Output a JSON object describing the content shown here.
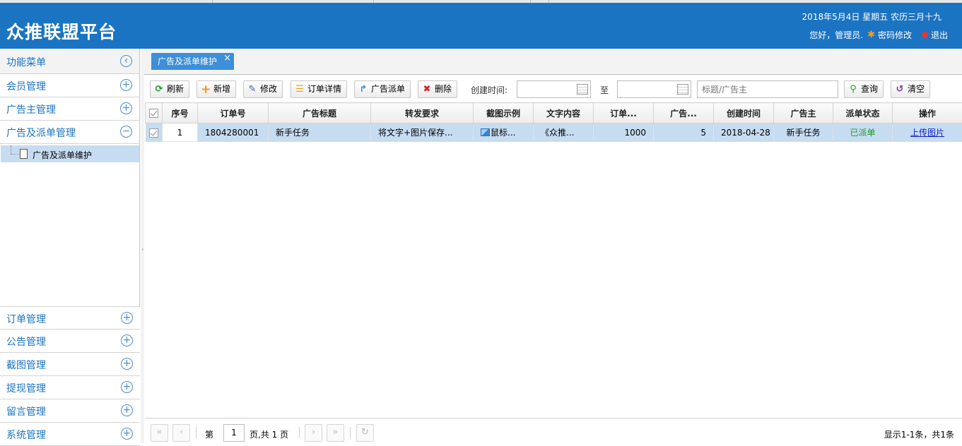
{
  "header": {
    "title": "众推联盟平台",
    "date": "2018年5月4日 星期五 农历三月十九",
    "greeting": "您好，管理员.",
    "change_password": "密码修改",
    "logout": "退出"
  },
  "sidebar": {
    "heading": "功能菜单",
    "items_top": [
      {
        "label": "会员管理",
        "toggle": "+"
      },
      {
        "label": "广告主管理",
        "toggle": "+"
      },
      {
        "label": "广告及派单管理",
        "toggle": "−"
      }
    ],
    "sub_item": "广告及派单维护",
    "items_bottom": [
      {
        "label": "订单管理",
        "toggle": "+"
      },
      {
        "label": "公告管理",
        "toggle": "+"
      },
      {
        "label": "截图管理",
        "toggle": "+"
      },
      {
        "label": "提现管理",
        "toggle": "+"
      },
      {
        "label": "留言管理",
        "toggle": "+"
      },
      {
        "label": "系统管理",
        "toggle": "+"
      }
    ]
  },
  "tab": {
    "label": "广告及派单维护",
    "close": "×"
  },
  "toolbar": {
    "refresh": "刷新",
    "add": "新增",
    "edit": "修改",
    "order_detail": "订单详情",
    "dispatch": "广告派单",
    "delete": "删除",
    "created_label": "创建时间:",
    "date_from": "",
    "to_label": "至",
    "date_to": "",
    "search_placeholder": "标题/广告主",
    "query": "查询",
    "clear": "清空"
  },
  "table": {
    "columns": [
      "序号",
      "订单号",
      "广告标题",
      "转发要求",
      "截图示例",
      "文字内容",
      "订单...",
      "广告...",
      "创建时间",
      "广告主",
      "派单状态",
      "操作"
    ],
    "rows": [
      {
        "index": "1",
        "order_no": "1804280001",
        "ad_title": "新手任务",
        "forward_req": "将文字+图片保存...",
        "screenshot": "鼠标...",
        "text_content": "《众推...",
        "order_count": "1000",
        "ad_count": "5",
        "created": "2018-04-28",
        "advertiser": "新手任务",
        "status": "已派单",
        "action": "上传图片"
      }
    ]
  },
  "pager": {
    "page_prefix": "第",
    "page_value": "1",
    "page_suffix": "页,共 1 页",
    "info": "显示1-1条，共1条"
  },
  "colors": {
    "header_bg": "#1b74c2",
    "tab_bg": "#3c8fd8",
    "selected_row": "#c6dcf0",
    "status_green": "#1d9b2a"
  }
}
